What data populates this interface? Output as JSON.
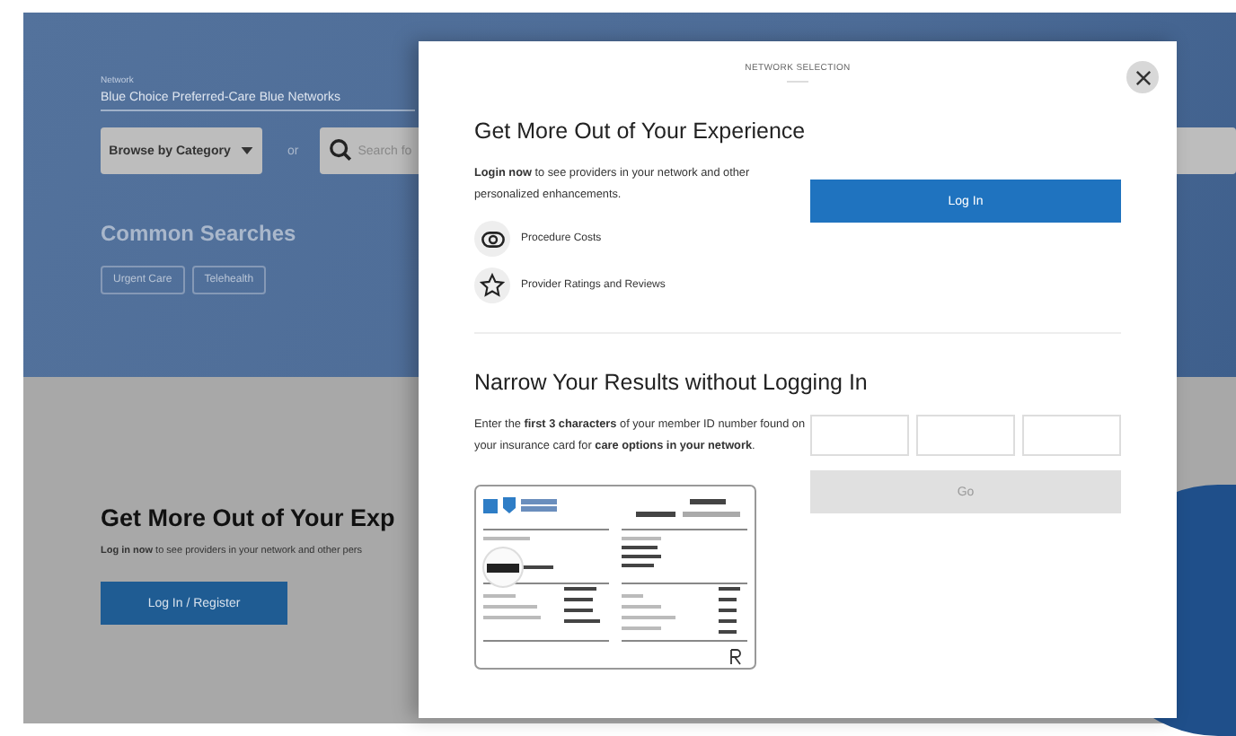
{
  "background_page": {
    "network_label": "Network",
    "network_value": "Blue Choice Preferred-Care Blue Networks",
    "browse_button": "Browse by Category",
    "or_text": "or",
    "search": {
      "placeholder": "Search fo"
    },
    "common_searches": {
      "title": "Common Searches",
      "chips": [
        "Urgent Care",
        "Telehealth"
      ]
    },
    "promo": {
      "title": "Get More Out of Your Exp",
      "text": "**Log in now** to see providers in your network and other pers",
      "button": "Log In / Register"
    }
  },
  "modal": {
    "title": "NETWORK SELECTION",
    "login_section": {
      "title": "Get More Out of Your Experience",
      "text": "**Login now** to see providers in your network and other personalized enhancements.",
      "button": "Log In",
      "features": [
        {
          "kind": "costs",
          "label": "Procedure Costs"
        },
        {
          "kind": "ratings",
          "label": "Provider Ratings and Reviews"
        }
      ]
    },
    "narrow_section": {
      "title": "Narrow Your Results without Logging In",
      "text": "Enter the **first 3 characters** of your member ID number found on your insurance card for **care options in your network**.",
      "go_button": {
        "label": "Go",
        "disabled": true
      }
    }
  }
}
